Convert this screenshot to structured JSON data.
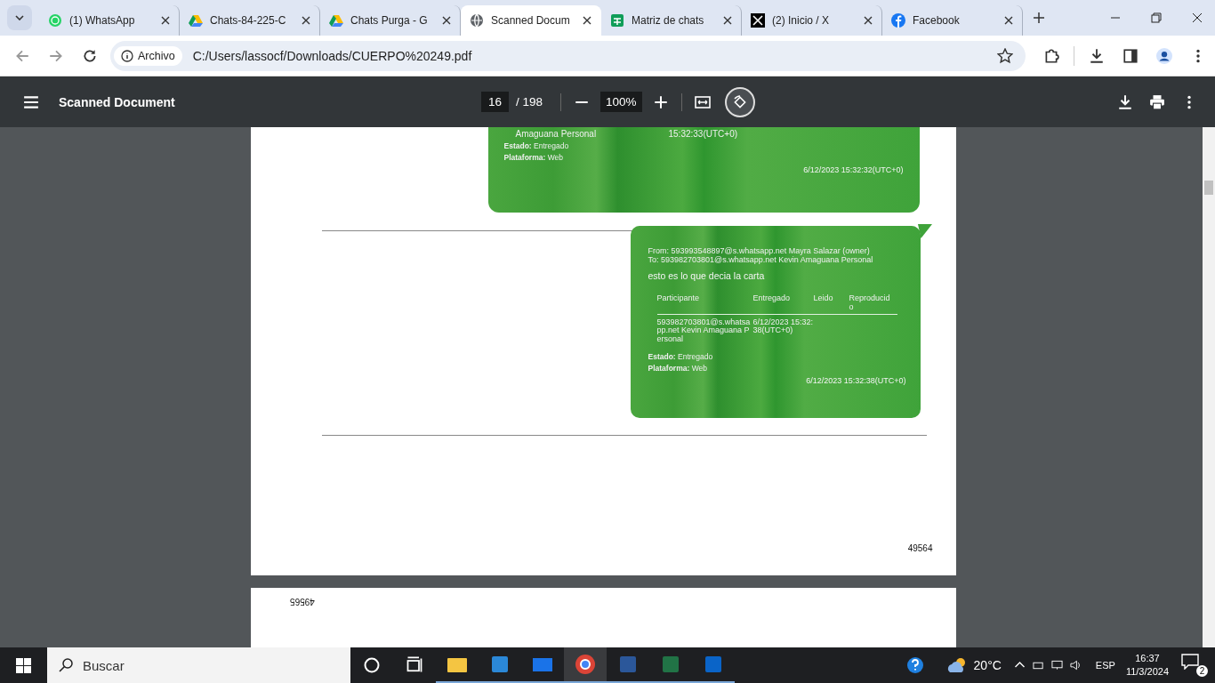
{
  "tabs": [
    {
      "title": "(1) WhatsApp",
      "selected": false
    },
    {
      "title": "Chats-84-225-C",
      "selected": false
    },
    {
      "title": "Chats Purga - G",
      "selected": false
    },
    {
      "title": "Scanned Docum",
      "selected": true
    },
    {
      "title": "Matriz de chats",
      "selected": false
    },
    {
      "title": "(2) Inicio / X",
      "selected": false
    },
    {
      "title": "Facebook",
      "selected": false
    }
  ],
  "address_bar": {
    "badge": "Archivo",
    "url": "C:/Users/lassocf/Downloads/CUERPO%20249.pdf"
  },
  "pdf_toolbar": {
    "title": "Scanned Document",
    "page": "16",
    "total": "/ 198",
    "zoom": "100%"
  },
  "page_1": {
    "message_1": {
      "recipient_tail": "Amaguana Personal",
      "delivered": "15:32:33(UTC+0)",
      "status": "**Estado:** Entregado",
      "platform": "**Plataforma:** Web",
      "timestamp": "6/12/2023 15:32:32(UTC+0)"
    },
    "message_2": {
      "from": "From: 593993548897@s.whatsapp.net Mayra Salazar (owner)",
      "to": "To: 593982703801@s.whatsapp.net Kevin Amaguana Personal",
      "body": "esto es lo que decia la carta",
      "columns": [
        "Participante",
        "Entregado",
        "Leido",
        "Reproducido"
      ],
      "row": [
        "593982703801@s.whatsapp.net Kevin Amaguana Personal",
        "6/12/2023 15:32:38(UTC+0)"
      ],
      "status": "**Estado:** Entregado",
      "platform": "**Plataforma:** Web",
      "timestamp": "6/12/2023 15:32:38(UTC+0)"
    },
    "page_number": "49564"
  },
  "page_2": {
    "page_number": "49565"
  },
  "taskbar": {
    "search_placeholder": "Buscar",
    "apps": [
      {
        "kind": "explorer",
        "selected": false
      },
      {
        "kind": "store",
        "selected": false
      },
      {
        "kind": "mail",
        "selected": false
      },
      {
        "kind": "chrome",
        "selected": true
      },
      {
        "kind": "word",
        "selected": false
      },
      {
        "kind": "excel",
        "selected": false
      },
      {
        "kind": "outlook",
        "selected": false
      }
    ],
    "temperature": "20°C",
    "language": "ESP",
    "time": "16:37",
    "date": "11/3/2024",
    "notifications": "2"
  }
}
